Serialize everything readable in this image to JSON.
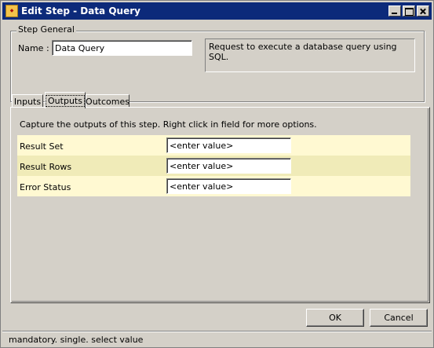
{
  "window": {
    "title": "Edit Step - Data Query",
    "icon": "app-icon"
  },
  "step_general": {
    "legend": "Step General",
    "name_label": "Name :",
    "name_value": "Data Query",
    "description": "Request to execute a database query using SQL."
  },
  "tabs": [
    {
      "label": "Inputs",
      "active": false
    },
    {
      "label": "Outputs",
      "active": true
    },
    {
      "label": "Outcomes",
      "active": false
    }
  ],
  "outputs": {
    "caption": "Capture the outputs of this step.  Right click in field for more options.",
    "rows": [
      {
        "label": "Result Set",
        "value": "<enter value>"
      },
      {
        "label": "Result Rows",
        "value": "<enter value>"
      },
      {
        "label": "Error Status",
        "value": "<enter value>"
      }
    ]
  },
  "buttons": {
    "ok": "OK",
    "cancel": "Cancel"
  },
  "status": {
    "text": "mandatory. single. select value"
  },
  "colors": {
    "titlebar": "#0c2a7a",
    "row_light": "#fff9d2",
    "row_alt": "#f0ebb8",
    "face": "#d4d0c8"
  }
}
